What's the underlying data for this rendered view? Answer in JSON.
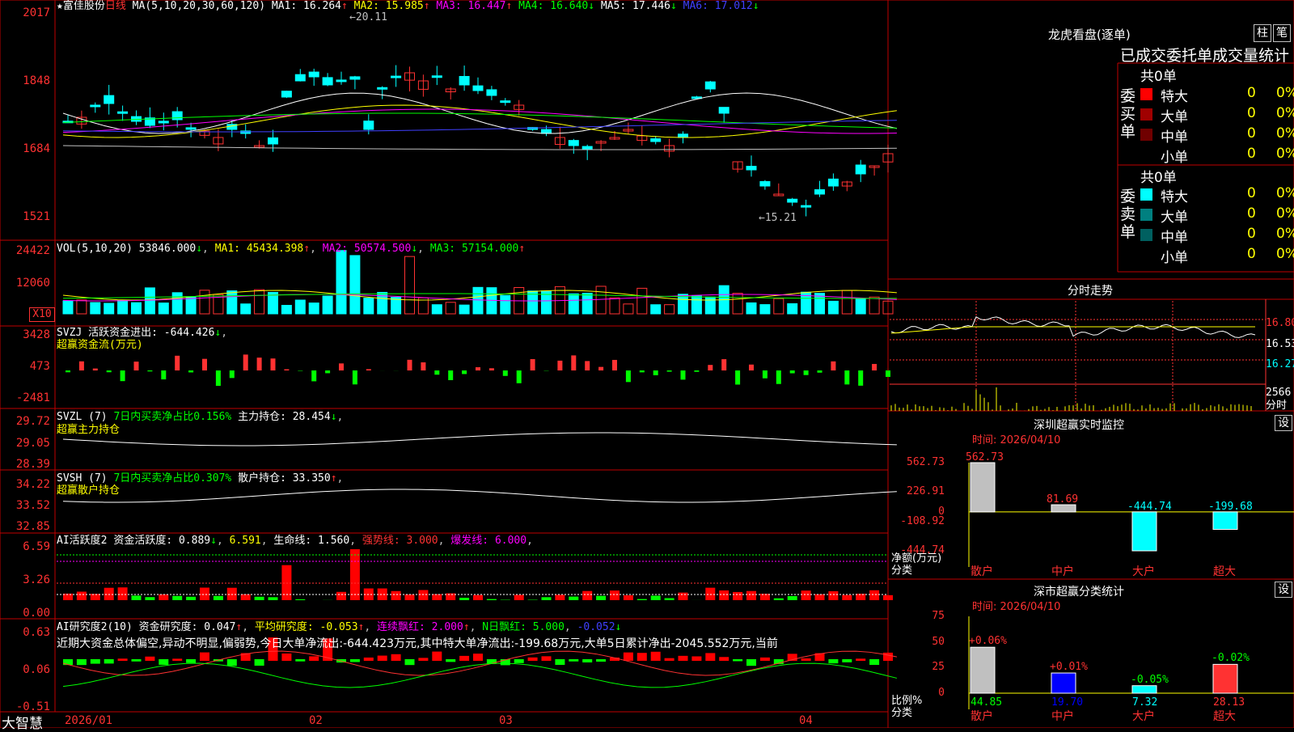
{
  "colors": {
    "up": "#ff3232",
    "down": "#00ffff",
    "border": "#c00000",
    "bg": "#000000",
    "ma1": "#ffffff",
    "ma2": "#ffff00",
    "ma3": "#ff00ff",
    "ma4": "#00ff00",
    "ma5": "#c0c0c0",
    "ma6": "#4040ff"
  },
  "main": {
    "stock_name": "★富佳股份",
    "period": "日线",
    "ma_params": "MA(5,10,20,30,60,120)",
    "ma1": "MA1: 16.264",
    "ma2": "MA2: 15.985",
    "ma3": "MA3: 16.447",
    "ma4": "MA4: 16.640",
    "ma5": "MA5: 17.446",
    "ma6": "MA6: 17.012",
    "high_label": "20.11",
    "low_label": "15.21",
    "y_ticks": [
      "2017",
      "1848",
      "1684",
      "1521"
    ]
  },
  "vol": {
    "title": "VOL(5,10,20)",
    "value": "53846.000",
    "ma1": "MA1: 45434.398",
    "ma2": "MA2: 50574.500",
    "ma3": "MA3: 57154.000",
    "y_ticks": [
      "24422",
      "12060"
    ],
    "unit": "X10"
  },
  "svzj": {
    "title": "SVZJ",
    "label": "活跃资金进出: -644.426",
    "sub": "超赢资金流(万元)",
    "y_ticks": [
      "3428",
      "473",
      "-2481"
    ]
  },
  "svzl": {
    "title": "SVZL (7)",
    "label1": "7日内买卖净占比0.156%",
    "label2": "主力持仓: 28.454",
    "sub": "超赢主力持仓",
    "y_ticks": [
      "29.72",
      "29.05",
      "28.39"
    ]
  },
  "svsh": {
    "title": "SVSH (7)",
    "label1": "7日内买卖净占比0.307%",
    "label2": "散户持仓: 33.350",
    "sub": "超赢散户持仓",
    "y_ticks": [
      "34.22",
      "33.52",
      "32.85"
    ]
  },
  "ai1": {
    "title": "AI活跃度2",
    "label1": "资金活跃度: 0.889",
    "label2": "6.591",
    "label3": "生命线: 1.560",
    "label4": "强势线: 3.000",
    "label5": "爆发线: 6.000",
    "y_ticks": [
      "6.59",
      "3.26",
      "0.00"
    ]
  },
  "ai2": {
    "title": "AI研究度2(10)",
    "label1": "资金研究度: 0.047",
    "label2": "平均研究度: -0.053",
    "label3": "连续飘红: 2.000",
    "label4": "N日飘红: 5.000",
    "label5": "-0.052",
    "y_ticks": [
      "0.63",
      "0.06",
      "-0.51"
    ],
    "commentary": "近期大资金总体偏空,异动不明显,偏弱势,今日大单净流出:-644.423万元,其中特大单净流出:-199.68万元,大单5日累计净出-2045.552万元,当前"
  },
  "xaxis": {
    "brand": "大智慧",
    "labels": [
      "2026/01",
      "02",
      "03",
      "04"
    ]
  },
  "longhu": {
    "title": "龙虎看盘(逐单)",
    "btn1": "柱",
    "btn2": "笔",
    "subtitle": "已成交委托单成交量统计",
    "buy_label": "委买单",
    "sell_label": "委卖单",
    "buy_total": "共0单",
    "sell_total": "共0单",
    "buy_rows": [
      {
        "name": "特大",
        "val": "0",
        "pct": "0%",
        "color": "#ff0000"
      },
      {
        "name": "大单",
        "val": "0",
        "pct": "0%",
        "color": "#a00000"
      },
      {
        "name": "中单",
        "val": "0",
        "pct": "0%",
        "color": "#700000"
      },
      {
        "name": "小单",
        "val": "0",
        "pct": "0%",
        "color": "#000000"
      }
    ],
    "sell_rows": [
      {
        "name": "特大",
        "val": "0",
        "pct": "0%",
        "color": "#00ffff"
      },
      {
        "name": "大单",
        "val": "0",
        "pct": "0%",
        "color": "#008080"
      },
      {
        "name": "中单",
        "val": "0",
        "pct": "0%",
        "color": "#006060"
      },
      {
        "name": "小单",
        "val": "0",
        "pct": "0%",
        "color": "#000000"
      }
    ]
  },
  "fenshi": {
    "title": "分时走势",
    "y_labels": [
      "16.80",
      "16.53",
      "16.27"
    ],
    "vol_label": "2566",
    "unit": "分时"
  },
  "sz_monitor": {
    "title": "深圳超赢实时监控",
    "btn": "设",
    "time": "时间: 2026/04/10",
    "y_ticks": [
      "562.73",
      "226.91",
      "0",
      "-108.92",
      "-444.74"
    ],
    "y_title": "净额(万元)",
    "x_title": "分类",
    "bars": [
      {
        "name": "散户",
        "value": 562.73,
        "label": "562.73"
      },
      {
        "name": "中户",
        "value": 81.69,
        "label": "81.69"
      },
      {
        "name": "大户",
        "value": -444.74,
        "label": "-444.74"
      },
      {
        "name": "超大",
        "value": -199.68,
        "label": "-199.68"
      }
    ]
  },
  "sz_class": {
    "title": "深市超赢分类统计",
    "btn": "设",
    "time": "时间: 2026/04/10",
    "y_ticks": [
      "75",
      "50",
      "25",
      "0"
    ],
    "y_title": "比例%",
    "x_title": "分类",
    "bars": [
      {
        "name": "散户",
        "value": 44.85,
        "label": "44.85",
        "delta": "+0.06%",
        "color": "#c0c0c0"
      },
      {
        "name": "中户",
        "value": 19.7,
        "label": "19.70",
        "delta": "+0.01%",
        "color": "#0000ff"
      },
      {
        "name": "大户",
        "value": 7.32,
        "label": "7.32",
        "delta": "-0.05%",
        "color": "#00ffff"
      },
      {
        "name": "超大",
        "value": 28.13,
        "label": "28.13",
        "delta": "-0.02%",
        "color": "#ff3232"
      }
    ]
  }
}
